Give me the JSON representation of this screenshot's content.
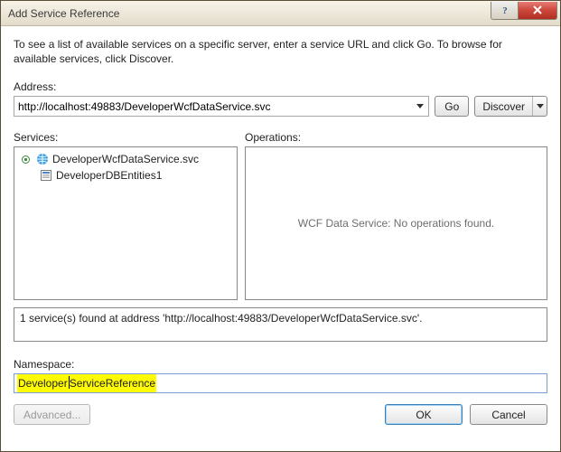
{
  "window": {
    "title": "Add Service Reference"
  },
  "intro": "To see a list of available services on a specific server, enter a service URL and click Go. To browse for available services, click Discover.",
  "labels": {
    "address": "Address:",
    "services": "Services:",
    "operations": "Operations:",
    "namespace": "Namespace:"
  },
  "address": {
    "value": "http://localhost:49883/DeveloperWcfDataService.svc"
  },
  "buttons": {
    "go": "Go",
    "discover": "Discover",
    "advanced": "Advanced...",
    "ok": "OK",
    "cancel": "Cancel"
  },
  "tree": {
    "root": "DeveloperWcfDataService.svc",
    "child": "DeveloperDBEntities1"
  },
  "operations": {
    "empty": "WCF Data Service: No operations found."
  },
  "status": "1 service(s) found at address 'http://localhost:49883/DeveloperWcfDataService.svc'.",
  "namespace": {
    "prefix": "Developer",
    "suffix": "ServiceReference"
  }
}
